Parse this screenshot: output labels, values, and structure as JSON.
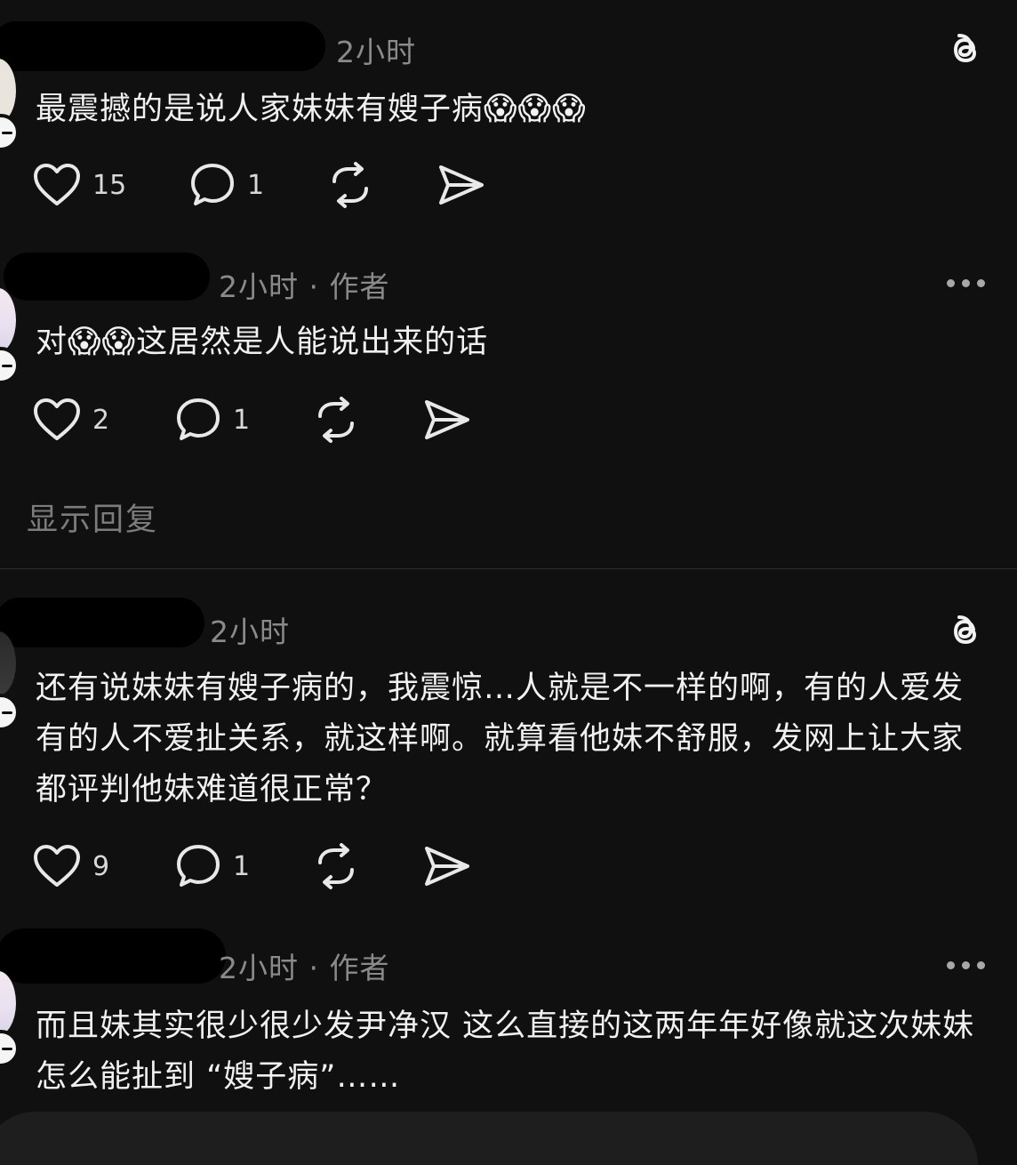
{
  "comments": [
    {
      "time": "2小时",
      "author_tag": "",
      "text": "最震撼的是说人家妹妹有嫂子病",
      "emojis": [
        "😱",
        "😱",
        "😱"
      ],
      "likes": "15",
      "replies": "1",
      "corner_icon": "threads-logo-icon"
    },
    {
      "time": "2小时",
      "author_tag": "作者",
      "text_pre": "对",
      "emojis": [
        "😱",
        "😱"
      ],
      "text_post": "这居然是人能说出来的话",
      "likes": "2",
      "replies": "1",
      "corner_icon": "more-icon"
    },
    {
      "time": "2小时",
      "author_tag": "",
      "text": "还有说妹妹有嫂子病的，我震惊…人就是不一样的啊，有的人爱发有的人不爱扯关系，就这样啊。就算看他妹不舒服，发网上让大家都评判他妹难道很正常？",
      "likes": "9",
      "replies": "1",
      "corner_icon": "threads-logo-icon"
    },
    {
      "time": "2小时",
      "author_tag": "作者",
      "text": "而且妹其实很少很少发尹净汉 这么直接的这两年年好像就这次妹妹怎么能扯到 “嫂子病”……",
      "corner_icon": "more-icon"
    }
  ],
  "show_replies_label": "显示回复",
  "separator": " · "
}
